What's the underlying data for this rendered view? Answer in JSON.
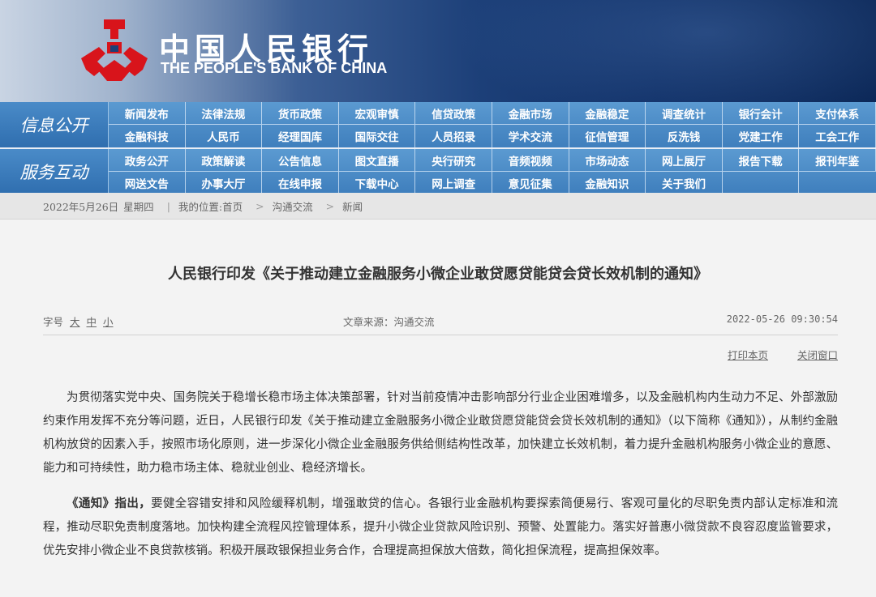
{
  "header": {
    "logo_cn": "中国人民银行",
    "logo_en": "THE PEOPLE'S BANK OF CHINA",
    "brand_red": "#d8141b"
  },
  "nav": {
    "info_title": "信息公开",
    "info_items": [
      "新闻发布",
      "法律法规",
      "货币政策",
      "宏观审慎",
      "信贷政策",
      "金融市场",
      "金融稳定",
      "调查统计",
      "银行会计",
      "支付体系",
      "金融科技",
      "人民币",
      "经理国库",
      "国际交往",
      "人员招录",
      "学术交流",
      "征信管理",
      "反洗钱",
      "党建工作",
      "工会工作"
    ],
    "service_title": "服务互动",
    "service_items": [
      "政务公开",
      "政策解读",
      "公告信息",
      "图文直播",
      "央行研究",
      "音频视频",
      "市场动态",
      "网上展厅",
      "报告下载",
      "报刊年鉴",
      "网送文告",
      "办事大厅",
      "在线申报",
      "下载中心",
      "网上调查",
      "意见征集",
      "金融知识",
      "关于我们",
      "",
      ""
    ]
  },
  "breadcrumb": {
    "date": "2022年5月26日",
    "weekday": "星期四",
    "location_label": "我的位置:首页",
    "level1": "沟通交流",
    "level2": "新闻",
    "separator": ">"
  },
  "article": {
    "title": "人民银行印发《关于推动建立金融服务小微企业敢贷愿贷能贷会贷长效机制的通知》",
    "fontsize_label": "字号",
    "fontsize_large": "大",
    "fontsize_medium": "中",
    "fontsize_small": "小",
    "source": "文章来源：沟通交流",
    "datetime": "2022-05-26 09:30:54",
    "print_label": "打印本页",
    "close_label": "关闭窗口",
    "para1": "为贯彻落实党中央、国务院关于稳增长稳市场主体决策部署，针对当前疫情冲击影响部分行业企业困难增多，以及金融机构内生动力不足、外部激励约束作用发挥不充分等问题，近日，人民银行印发《关于推动建立金融服务小微企业敢贷愿贷能贷会贷长效机制的通知》（以下简称《通知》），从制约金融机构放贷的因素入手，按照市场化原则，进一步深化小微企业金融服务供给侧结构性改革，加快建立长效机制，着力提升金融机构服务小微企业的意愿、能力和可持续性，助力稳市场主体、稳就业创业、稳经济增长。",
    "para2_lead": "《通知》指出，",
    "para2_rest": "要健全容错安排和风险缓释机制，增强敢贷的信心。各银行业金融机构要探索简便易行、客观可量化的尽职免责内部认定标准和流程，推动尽职免责制度落地。加快构建全流程风控管理体系，提升小微企业贷款风险识别、预警、处置能力。落实好普惠小微贷款不良容忍度监管要求，优先安排小微企业不良贷款核销。积极开展政银保担业务合作，合理提高担保放大倍数，简化担保流程，提高担保效率。"
  }
}
